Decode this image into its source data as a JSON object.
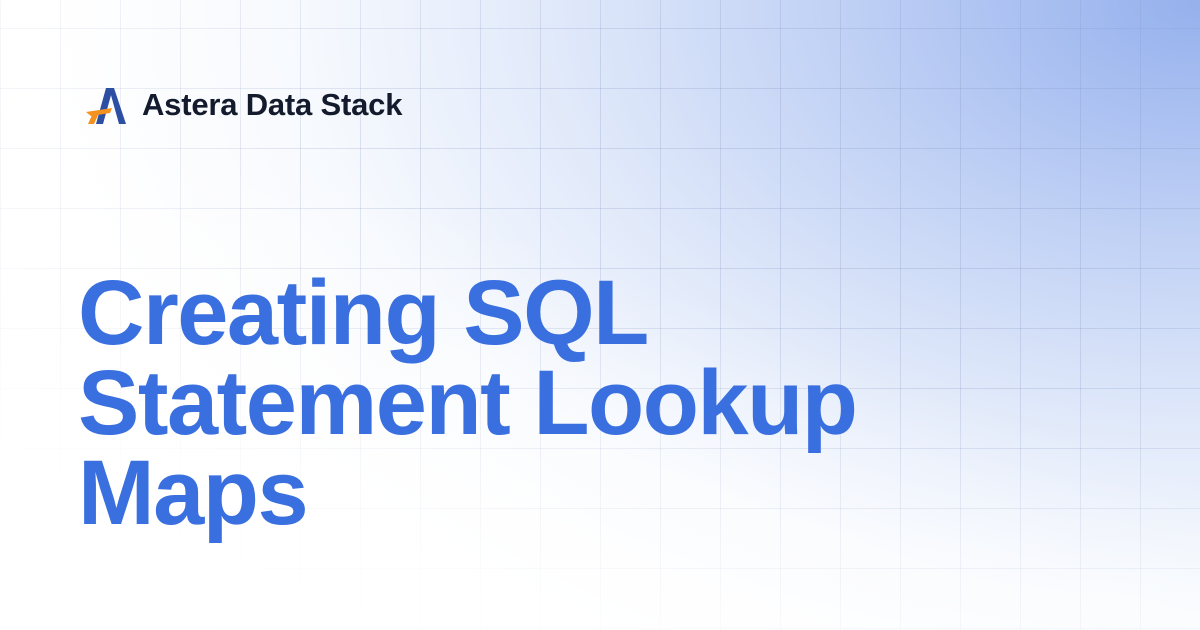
{
  "brand": {
    "name": "Astera Data Stack",
    "logo_icon": "astera-a-logo-icon",
    "logo_colors": {
      "primary": "#2d4fa3",
      "accent": "#f3921f"
    }
  },
  "headline": {
    "lines": [
      "Creating SQL",
      "Statement Lookup",
      "Maps"
    ],
    "color": "#3a6fe0"
  },
  "background": {
    "gradient_color": "#8facec",
    "grid": true
  }
}
